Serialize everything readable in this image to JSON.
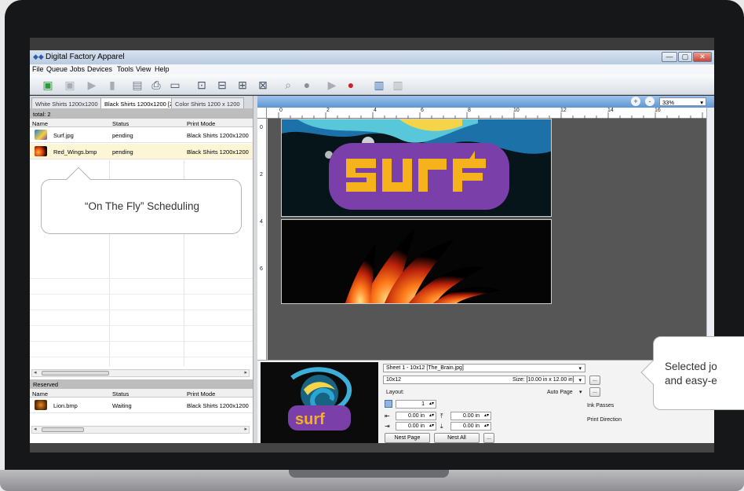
{
  "window": {
    "title": "Digital Factory Apparel",
    "minimize": "—",
    "maximize": "▢",
    "close": "✕"
  },
  "menu": [
    "File",
    "Queue",
    "Jobs",
    "Devices",
    "Tools",
    "View",
    "Help"
  ],
  "toolbar_icons": [
    "add-job-icon",
    "delete-job-icon",
    "play-icon",
    "pause-icon",
    "document-icon",
    "printer-icon",
    "monitor-icon",
    "layout-center-icon",
    "layout-fit-icon",
    "layout-frame-icon",
    "layout-scale-icon",
    "magnify-icon",
    "stop-icon",
    "print-start-icon",
    "print-stop-icon",
    "queue-list-icon",
    "queue-stack-icon"
  ],
  "queue_tabs": [
    {
      "label": "White Shirts 1200x1200",
      "active": false
    },
    {
      "label": "Black Shirts 1200x1200 [2]",
      "active": true
    },
    {
      "label": "Color Shirts 1200 x 1200",
      "active": false
    }
  ],
  "queue": {
    "total": "total: 2",
    "columns": [
      "Name",
      "Status",
      "Print Mode"
    ],
    "rows": [
      {
        "name": "Surf.jpg",
        "status": "pending",
        "mode": "Black Shirts 1200x1200",
        "selected": false
      },
      {
        "name": "Red_Wings.bmp",
        "status": "pending",
        "mode": "Black Shirts 1200x1200",
        "selected": true
      }
    ]
  },
  "reserved": {
    "title": "Reserved",
    "columns": [
      "Name",
      "Status",
      "Print Mode"
    ],
    "rows": [
      {
        "name": "Lion.bmp",
        "status": "Waiting",
        "mode": "Black Shirts 1200x1200"
      }
    ]
  },
  "callouts": {
    "scheduling": "“On The Fly” Scheduling",
    "selected_line1": "Selected jo",
    "selected_line2": "and easy-e"
  },
  "zoom": {
    "value": "33%",
    "zoom_in": "+",
    "zoom_out": "-"
  },
  "ruler": {
    "top": [
      "0",
      "2",
      "4",
      "6",
      "8",
      "10",
      "12",
      "14",
      "16"
    ],
    "left": [
      "0",
      "2",
      "4",
      "6"
    ]
  },
  "artwork": {
    "word": "surf"
  },
  "sheet": {
    "selector": "Sheet 1 - 10x12 [The_Brain.jpg]",
    "name": "10x12",
    "size_label": "Size: [10.00 in x 12.00 in]",
    "layout_label": "Layout:",
    "layout_value": "Auto Page",
    "copies": "1",
    "margin_left": "0.00 in",
    "margin_top": "0.00 in",
    "margin_right": "0.00 in",
    "margin_bottom": "0.00 in",
    "ink_passes": "Ink Passes",
    "print_direction": "Print Direction",
    "nest_page": "Nest Page",
    "nest_all": "Nest All",
    "ellipsis": "...",
    "preview_word": "surf"
  },
  "scroll": {
    "left_arrow": "◂",
    "right_arrow": "▸",
    "thumb": "III"
  },
  "colors": {
    "accent": "#5f95d1",
    "surf_purple": "#7a3fa8",
    "surf_yellow": "#f6b21b",
    "selected_row": "#fcf6d6"
  }
}
